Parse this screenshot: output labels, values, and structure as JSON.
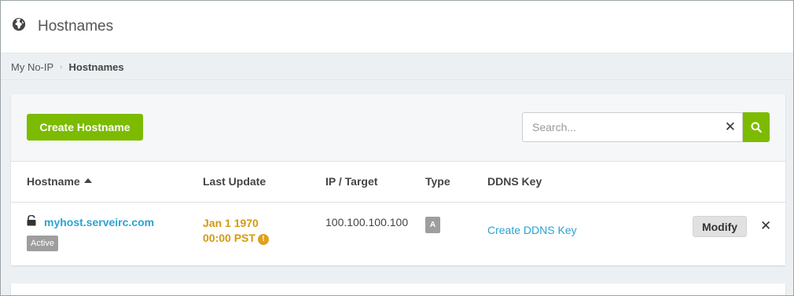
{
  "header": {
    "title": "Hostnames",
    "icon": "globe-icon"
  },
  "breadcrumb": {
    "root": "My No-IP",
    "current": "Hostnames"
  },
  "toolbar": {
    "create_label": "Create Hostname",
    "search_placeholder": "Search...",
    "clear_symbol": "✕"
  },
  "table": {
    "columns": [
      "Hostname",
      "Last Update",
      "IP / Target",
      "Type",
      "DDNS Key"
    ],
    "rows": [
      {
        "hostname": "myhost.serveirc.com",
        "status": "Active",
        "last_update_date": "Jan 1 1970",
        "last_update_time": "00:00 PST",
        "ip": "100.100.100.100",
        "type": "A",
        "ddns": "Create DDNS Key",
        "modify_label": "Modify",
        "delete_symbol": "✕"
      }
    ]
  },
  "colors": {
    "accent": "#7cbb00",
    "link": "#2aa3d2",
    "warning": "#d49a12",
    "badge": "#9e9e9e"
  }
}
